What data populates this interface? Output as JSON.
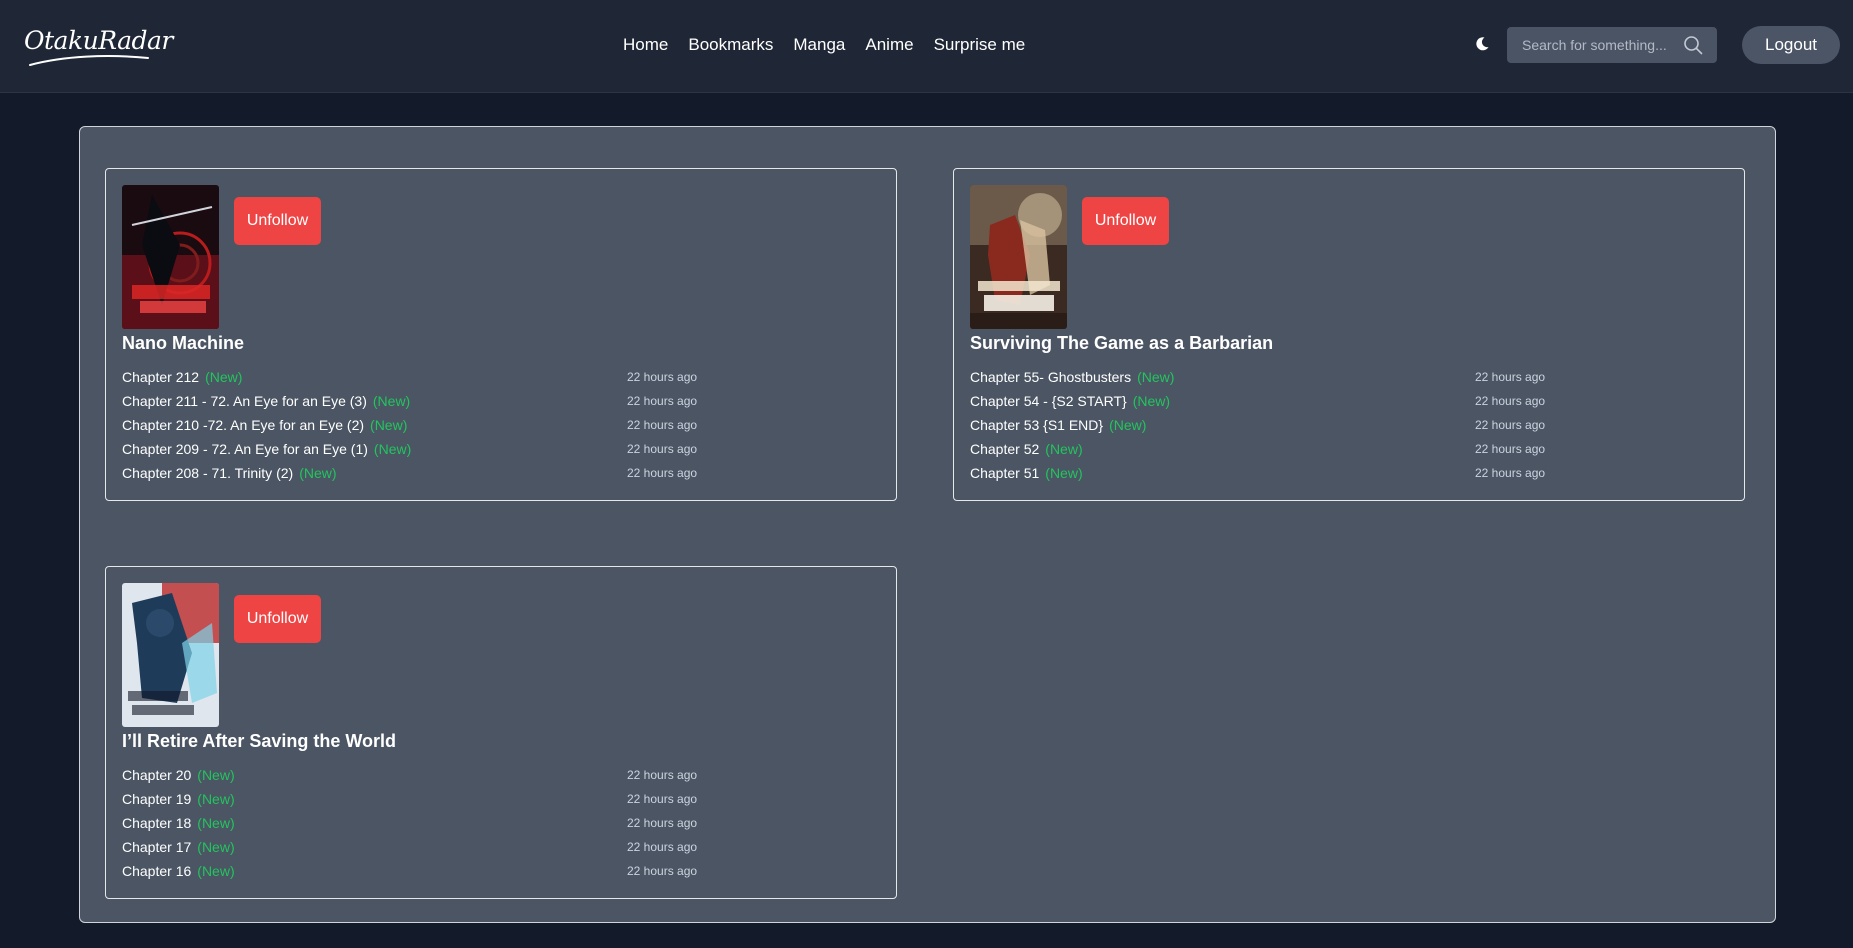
{
  "header": {
    "logo": "OtakuRadar",
    "nav": [
      "Home",
      "Bookmarks",
      "Manga",
      "Anime",
      "Surprise me"
    ],
    "search_placeholder": "Search for something...",
    "logout_label": "Logout"
  },
  "colors": {
    "unfollow_button": "#ef4444",
    "new_badge": "#22c55e",
    "panel": "#4b5563",
    "background": "#131a2a"
  },
  "icons": {
    "theme": "moon-icon",
    "search": "search-icon"
  },
  "follows": [
    {
      "title": "Nano Machine",
      "unfollow_label": "Unfollow",
      "chapters": [
        {
          "name": "Chapter 212",
          "badge": "(New)",
          "time": "22 hours ago"
        },
        {
          "name": "Chapter 211 - 72. An Eye for an Eye (3)",
          "badge": "(New)",
          "time": "22 hours ago"
        },
        {
          "name": "Chapter 210 -72. An Eye for an Eye (2)",
          "badge": "(New)",
          "time": "22 hours ago"
        },
        {
          "name": "Chapter 209 - 72. An Eye for an Eye (1)",
          "badge": "(New)",
          "time": "22 hours ago"
        },
        {
          "name": "Chapter 208 - 71. Trinity (2)",
          "badge": "(New)",
          "time": "22 hours ago"
        }
      ]
    },
    {
      "title": "Surviving The Game as a Barbarian",
      "unfollow_label": "Unfollow",
      "chapters": [
        {
          "name": "Chapter 55- Ghostbusters",
          "badge": "(New)",
          "time": "22 hours ago"
        },
        {
          "name": "Chapter 54 - {S2 START}",
          "badge": "(New)",
          "time": "22 hours ago"
        },
        {
          "name": "Chapter 53 {S1 END}",
          "badge": "(New)",
          "time": "22 hours ago"
        },
        {
          "name": "Chapter 52",
          "badge": "(New)",
          "time": "22 hours ago"
        },
        {
          "name": "Chapter 51",
          "badge": "(New)",
          "time": "22 hours ago"
        }
      ]
    },
    {
      "title": "I’ll Retire After Saving the World",
      "unfollow_label": "Unfollow",
      "chapters": [
        {
          "name": "Chapter 20",
          "badge": "(New)",
          "time": "22 hours ago"
        },
        {
          "name": "Chapter 19",
          "badge": "(New)",
          "time": "22 hours ago"
        },
        {
          "name": "Chapter 18",
          "badge": "(New)",
          "time": "22 hours ago"
        },
        {
          "name": "Chapter 17",
          "badge": "(New)",
          "time": "22 hours ago"
        },
        {
          "name": "Chapter 16",
          "badge": "(New)",
          "time": "22 hours ago"
        }
      ]
    }
  ]
}
